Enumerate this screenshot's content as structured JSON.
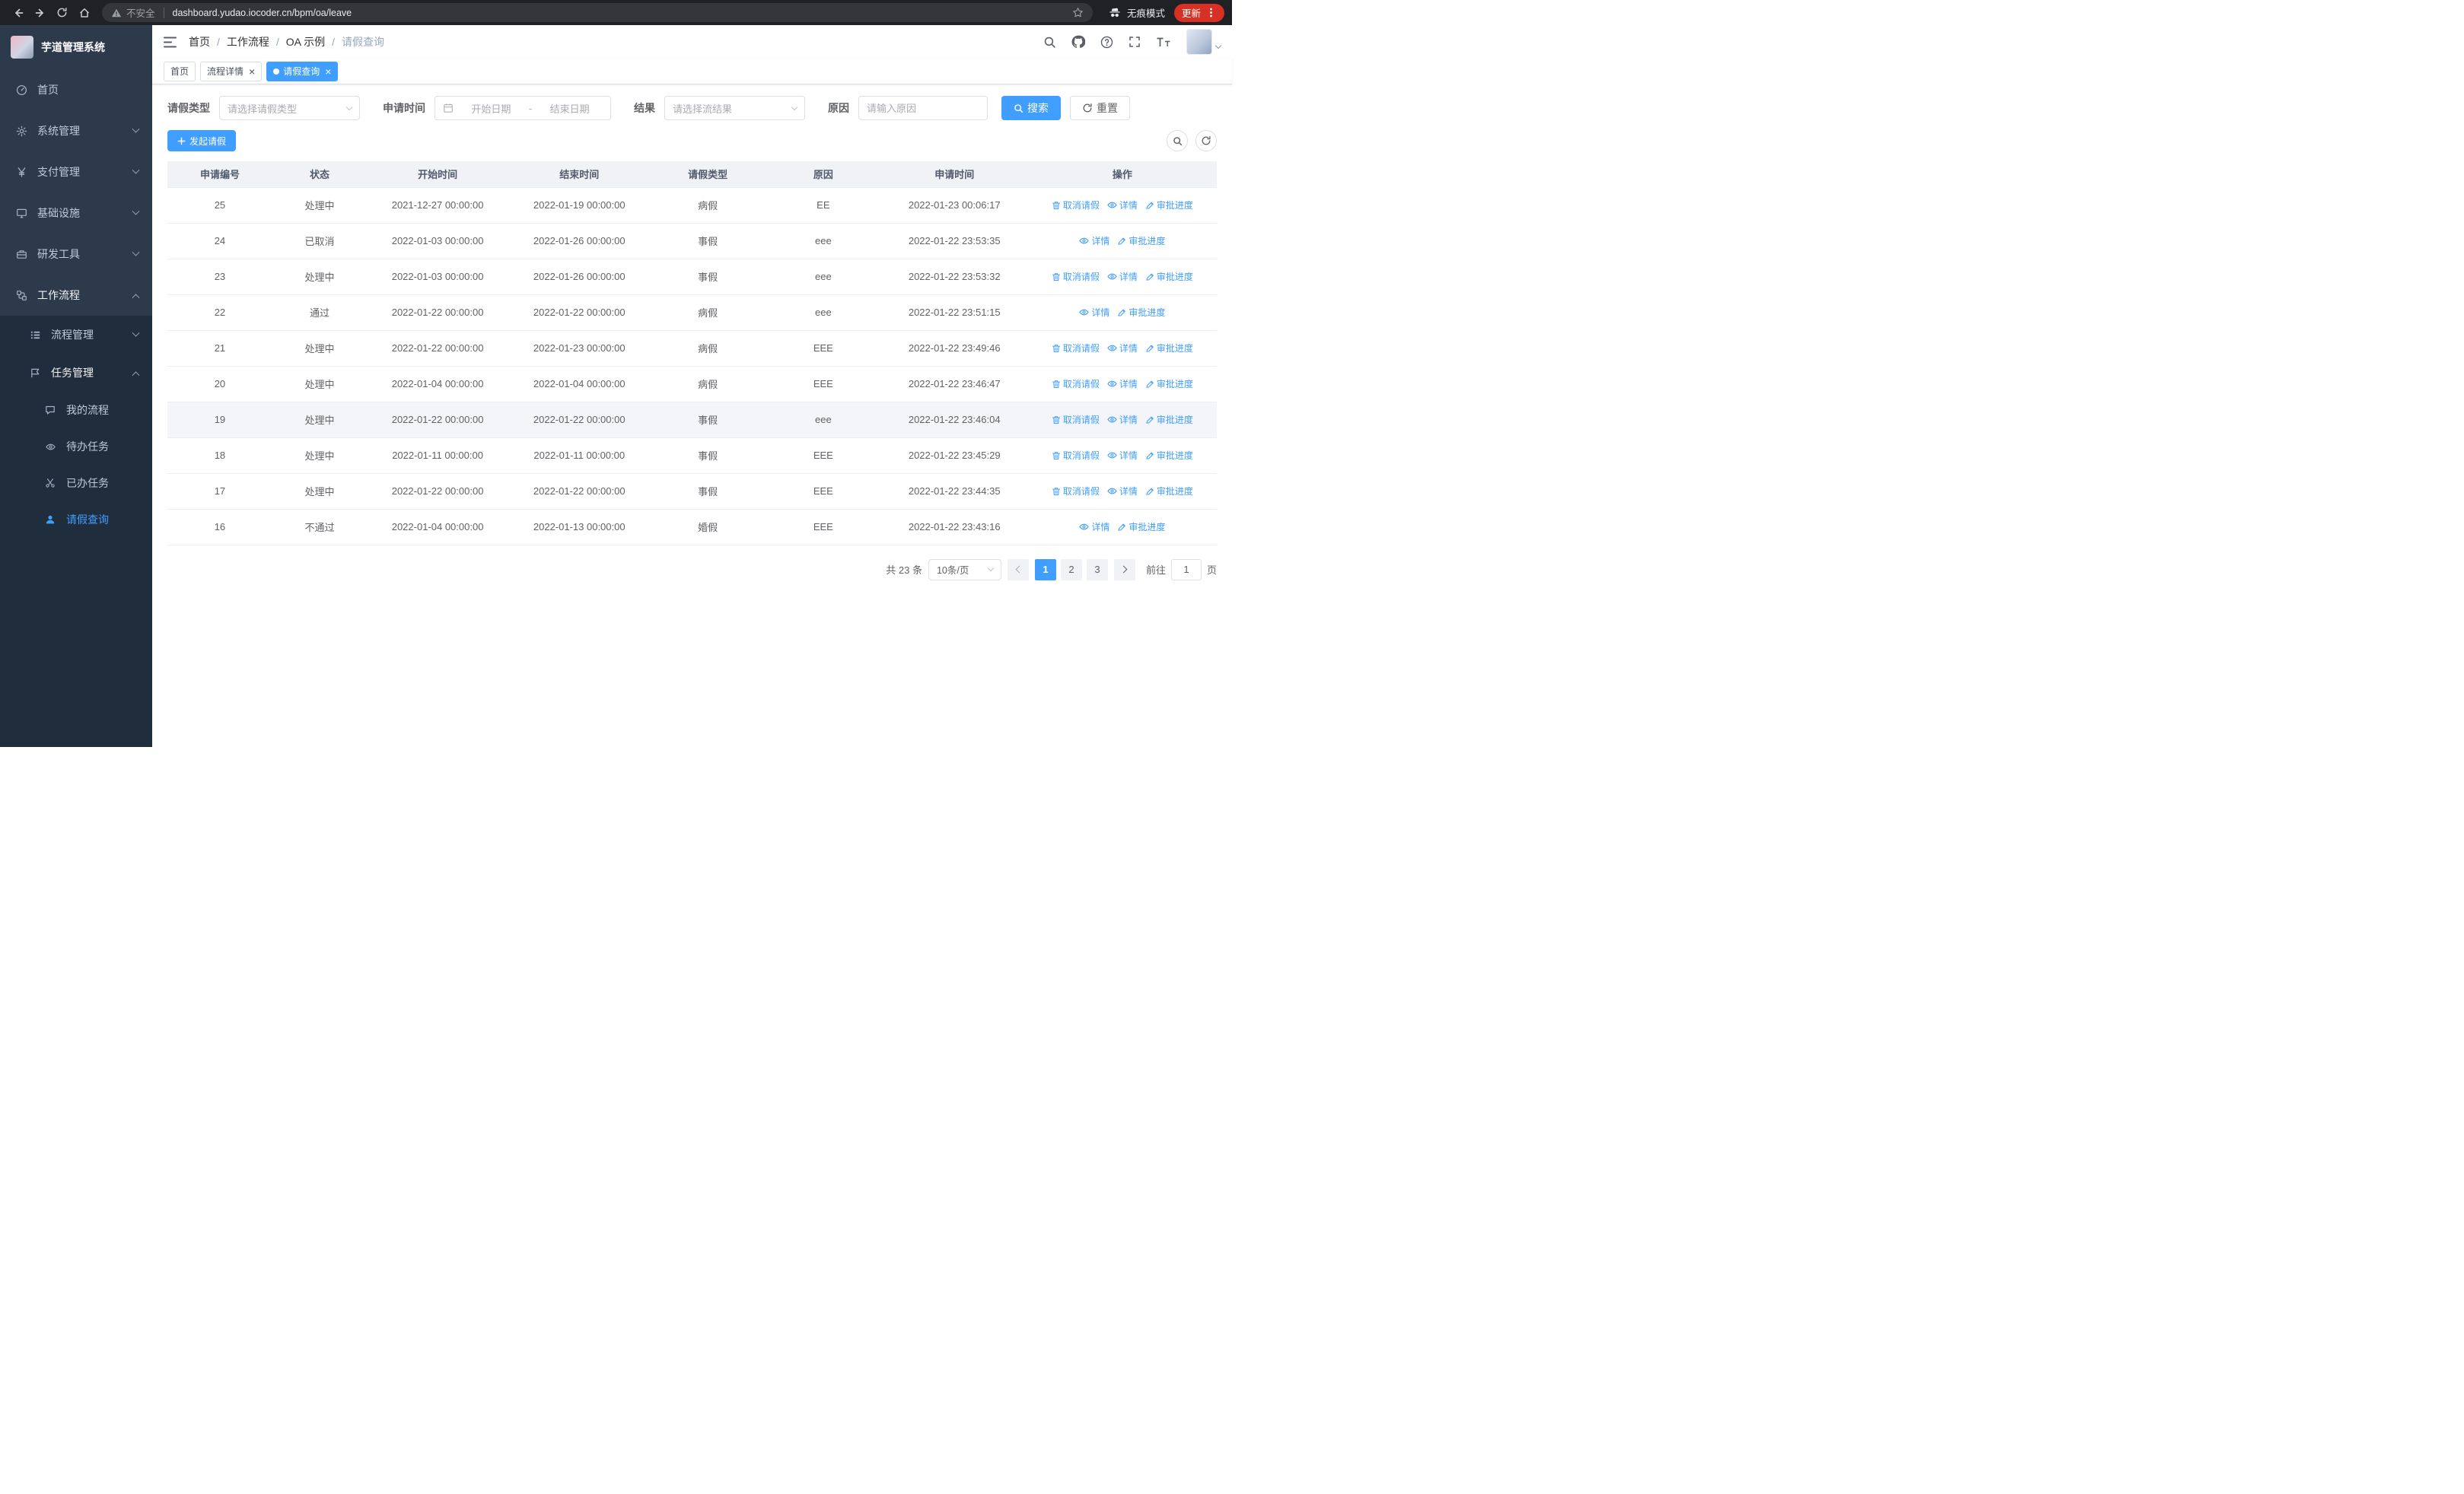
{
  "browser": {
    "security_label": "不安全",
    "url": "dashboard.yudao.iocoder.cn/bpm/oa/leave",
    "incognito_label": "无痕模式",
    "update_label": "更新"
  },
  "sidebar": {
    "logo_title": "芋道管理系统",
    "items": [
      {
        "key": "home",
        "label": "首页",
        "icon": "dashboard-icon",
        "expandable": false,
        "expanded": false,
        "active": false
      },
      {
        "key": "system",
        "label": "系统管理",
        "icon": "gear-icon",
        "expandable": true,
        "expanded": false,
        "active": false
      },
      {
        "key": "payment",
        "label": "支付管理",
        "icon": "money-icon",
        "expandable": true,
        "expanded": false,
        "active": false
      },
      {
        "key": "infra",
        "label": "基础设施",
        "icon": "infra-icon",
        "expandable": true,
        "expanded": false,
        "active": false
      },
      {
        "key": "devtools",
        "label": "研发工具",
        "icon": "tools-icon",
        "expandable": true,
        "expanded": false,
        "active": false
      },
      {
        "key": "workflow",
        "label": "工作流程",
        "icon": "workflow-icon",
        "expandable": true,
        "expanded": true,
        "active": true
      }
    ],
    "submenu": [
      {
        "key": "process-mgmt",
        "label": "流程管理",
        "icon": "process-icon",
        "expandable": true,
        "expanded": false,
        "children": []
      },
      {
        "key": "task-mgmt",
        "label": "任务管理",
        "icon": "task-icon",
        "expandable": true,
        "expanded": true,
        "children": [
          {
            "key": "my-process",
            "label": "我的流程",
            "icon": "chat-icon",
            "active": false
          },
          {
            "key": "todo-task",
            "label": "待办任务",
            "icon": "eye-icon",
            "active": false
          },
          {
            "key": "done-task",
            "label": "已办任务",
            "icon": "scissors-icon",
            "active": false
          },
          {
            "key": "leave-query",
            "label": "请假查询",
            "icon": "user-icon",
            "active": true
          }
        ]
      }
    ]
  },
  "header": {
    "breadcrumb": [
      "首页",
      "工作流程",
      "OA 示例",
      "请假查询"
    ]
  },
  "tabs": [
    {
      "key": "home",
      "label": "首页",
      "closable": false,
      "active": false
    },
    {
      "key": "process-detail",
      "label": "流程详情",
      "closable": true,
      "active": false
    },
    {
      "key": "leave-query",
      "label": "请假查询",
      "closable": true,
      "active": true
    }
  ],
  "filters": {
    "leave_type_label": "请假类型",
    "leave_type_placeholder": "请选择请假类型",
    "apply_time_label": "申请时间",
    "start_date_placeholder": "开始日期",
    "range_separator": "-",
    "end_date_placeholder": "结束日期",
    "result_label": "结果",
    "result_placeholder": "请选择流结果",
    "reason_label": "原因",
    "reason_placeholder": "请输入原因",
    "search_label": "搜索",
    "reset_label": "重置"
  },
  "toolbar": {
    "create_label": "发起请假"
  },
  "table": {
    "headers": [
      "申请编号",
      "状态",
      "开始时间",
      "结束时间",
      "请假类型",
      "原因",
      "申请时间",
      "操作"
    ],
    "action_labels": {
      "cancel": "取消请假",
      "detail": "详情",
      "progress": "审批进度"
    },
    "rows": [
      {
        "id": "25",
        "status": "处理中",
        "start": "2021-12-27 00:00:00",
        "end": "2022-01-19 00:00:00",
        "type": "病假",
        "reason": "EE",
        "applied": "2022-01-23 00:06:17",
        "actions": [
          "cancel",
          "detail",
          "progress"
        ],
        "highlight": false
      },
      {
        "id": "24",
        "status": "已取消",
        "start": "2022-01-03 00:00:00",
        "end": "2022-01-26 00:00:00",
        "type": "事假",
        "reason": "eee",
        "applied": "2022-01-22 23:53:35",
        "actions": [
          "detail",
          "progress"
        ],
        "highlight": false
      },
      {
        "id": "23",
        "status": "处理中",
        "start": "2022-01-03 00:00:00",
        "end": "2022-01-26 00:00:00",
        "type": "事假",
        "reason": "eee",
        "applied": "2022-01-22 23:53:32",
        "actions": [
          "cancel",
          "detail",
          "progress"
        ],
        "highlight": false
      },
      {
        "id": "22",
        "status": "通过",
        "start": "2022-01-22 00:00:00",
        "end": "2022-01-22 00:00:00",
        "type": "病假",
        "reason": "eee",
        "applied": "2022-01-22 23:51:15",
        "actions": [
          "detail",
          "progress"
        ],
        "highlight": false
      },
      {
        "id": "21",
        "status": "处理中",
        "start": "2022-01-22 00:00:00",
        "end": "2022-01-23 00:00:00",
        "type": "病假",
        "reason": "EEE",
        "applied": "2022-01-22 23:49:46",
        "actions": [
          "cancel",
          "detail",
          "progress"
        ],
        "highlight": false
      },
      {
        "id": "20",
        "status": "处理中",
        "start": "2022-01-04 00:00:00",
        "end": "2022-01-04 00:00:00",
        "type": "病假",
        "reason": "EEE",
        "applied": "2022-01-22 23:46:47",
        "actions": [
          "cancel",
          "detail",
          "progress"
        ],
        "highlight": false
      },
      {
        "id": "19",
        "status": "处理中",
        "start": "2022-01-22 00:00:00",
        "end": "2022-01-22 00:00:00",
        "type": "事假",
        "reason": "eee",
        "applied": "2022-01-22 23:46:04",
        "actions": [
          "cancel",
          "detail",
          "progress"
        ],
        "highlight": true
      },
      {
        "id": "18",
        "status": "处理中",
        "start": "2022-01-11 00:00:00",
        "end": "2022-01-11 00:00:00",
        "type": "事假",
        "reason": "EEE",
        "applied": "2022-01-22 23:45:29",
        "actions": [
          "cancel",
          "detail",
          "progress"
        ],
        "highlight": false
      },
      {
        "id": "17",
        "status": "处理中",
        "start": "2022-01-22 00:00:00",
        "end": "2022-01-22 00:00:00",
        "type": "事假",
        "reason": "EEE",
        "applied": "2022-01-22 23:44:35",
        "actions": [
          "cancel",
          "detail",
          "progress"
        ],
        "highlight": false
      },
      {
        "id": "16",
        "status": "不通过",
        "start": "2022-01-04 00:00:00",
        "end": "2022-01-13 00:00:00",
        "type": "婚假",
        "reason": "EEE",
        "applied": "2022-01-22 23:43:16",
        "actions": [
          "detail",
          "progress"
        ],
        "highlight": false
      }
    ]
  },
  "pagination": {
    "total_label": "共 23 条",
    "page_size_label": "10条/页",
    "pages": [
      "1",
      "2",
      "3"
    ],
    "active_page": "1",
    "goto_label": "前往",
    "goto_value": "1",
    "goto_suffix": "页"
  },
  "colors": {
    "primary": "#409eff",
    "sidebar_bg": "#2d3a4b",
    "submenu_bg": "#1f2d3d",
    "update_pill": "#d93025"
  }
}
